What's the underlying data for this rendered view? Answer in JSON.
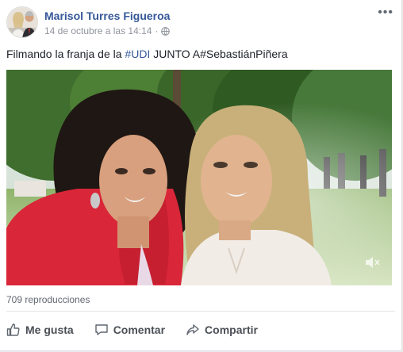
{
  "post": {
    "author": "Marisol Turres Figueroa",
    "timestamp": "14 de octubre a las 14:14",
    "separator": "·",
    "privacy_icon": "globe-icon",
    "more_icon": "more-options-icon",
    "more_symbol": "•••"
  },
  "message": {
    "before_tag": "Filmando la franja de la ",
    "hashtag": "#UDI",
    "after_tag": " JUNTO A#SebastiánPiñera"
  },
  "video": {
    "views": "709 reproducciones",
    "mute_icon": "muted-speaker-icon"
  },
  "actions": {
    "like": "Me gusta",
    "comment": "Comentar",
    "share": "Compartir"
  },
  "colors": {
    "link": "#365899",
    "text": "#1d2129",
    "muted": "#90949c"
  }
}
